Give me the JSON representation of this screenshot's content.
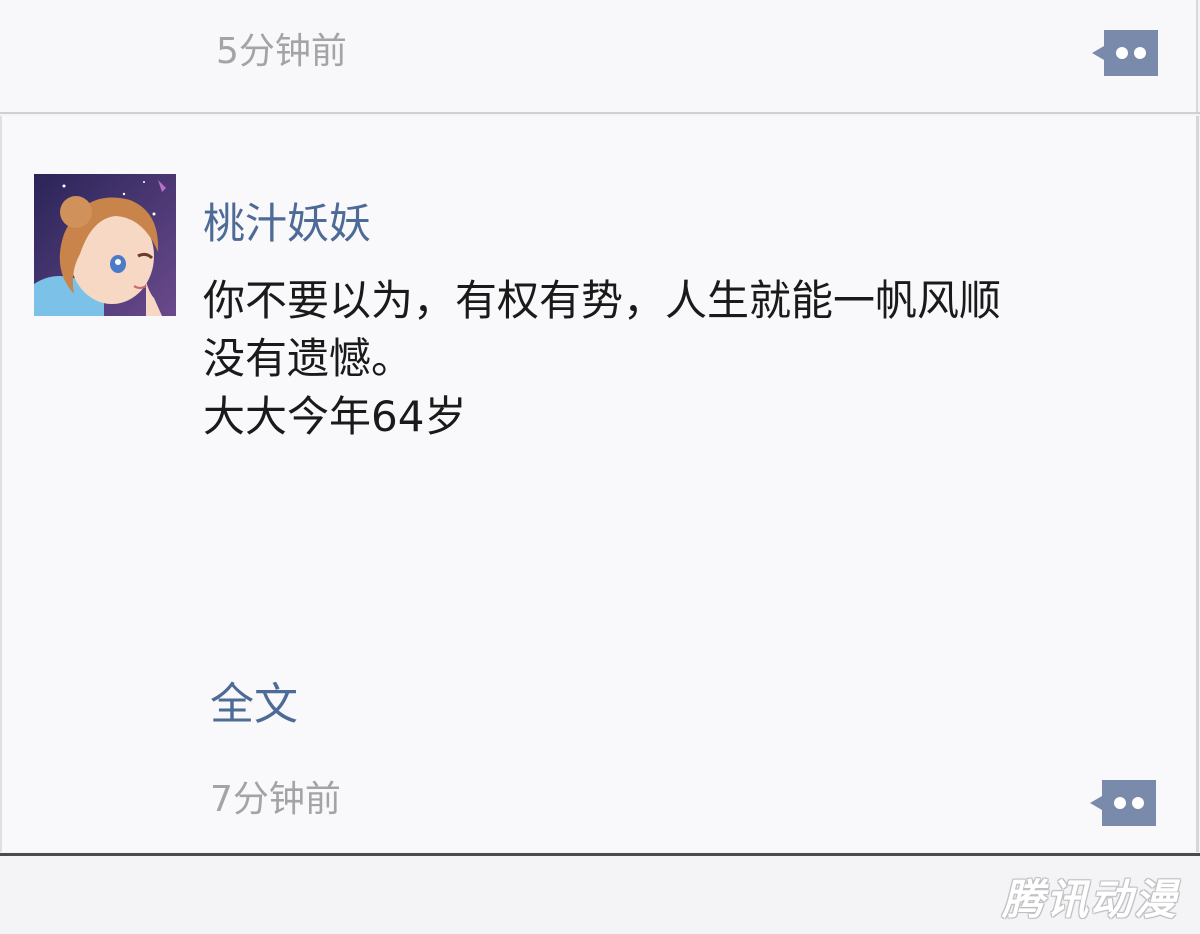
{
  "previous_comment": {
    "timestamp": "5分钟前",
    "reply_icon": "reply-bubble-icon"
  },
  "comment": {
    "avatar_icon": "user-avatar",
    "username": "桃汁妖妖",
    "text": "你不要以为，有权有势，人生就能一帆风顺\n没有遗憾。\n大大今年64岁",
    "full_text_link": "全文",
    "timestamp": "7分钟前",
    "reply_icon": "reply-bubble-icon"
  },
  "watermark": "腾讯动漫",
  "colors": {
    "username": "#4e6a96",
    "link": "#4e6a96",
    "timestamp": "#a4a4a8",
    "reply_icon": "#7a8aaa",
    "background": "#f4f4f6"
  }
}
